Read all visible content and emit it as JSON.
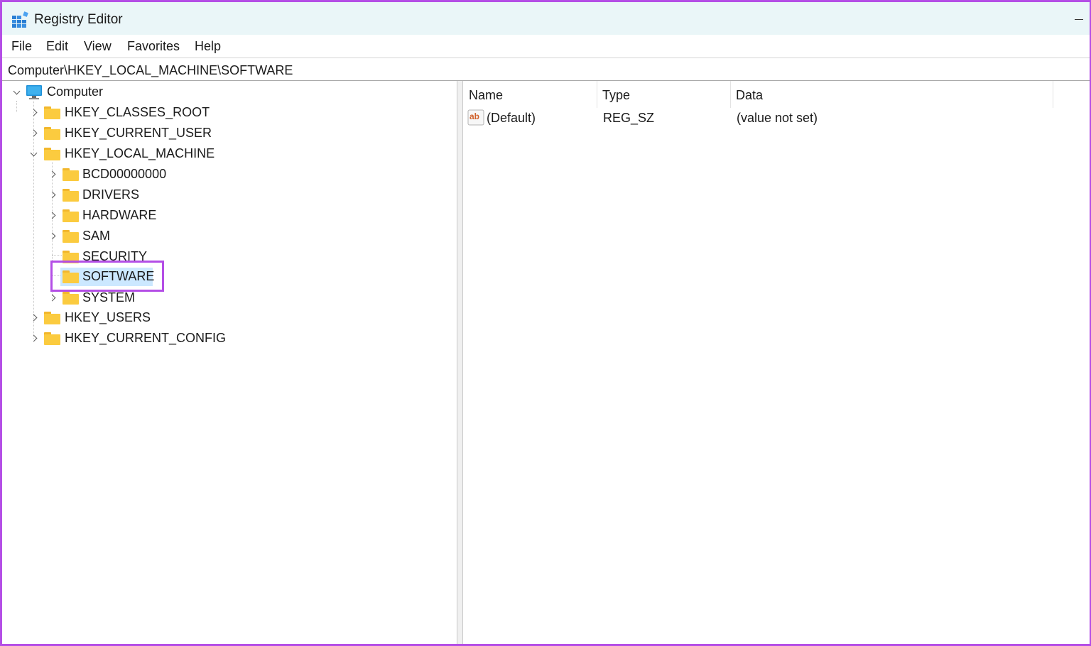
{
  "window": {
    "title": "Registry Editor"
  },
  "menu": {
    "items": [
      "File",
      "Edit",
      "View",
      "Favorites",
      "Help"
    ]
  },
  "address": {
    "path": "Computer\\HKEY_LOCAL_MACHINE\\SOFTWARE"
  },
  "tree": {
    "root": "Computer",
    "hives": {
      "classes_root": "HKEY_CLASSES_ROOT",
      "current_user": "HKEY_CURRENT_USER",
      "local_machine": "HKEY_LOCAL_MACHINE",
      "users": "HKEY_USERS",
      "current_config": "HKEY_CURRENT_CONFIG"
    },
    "local_machine_children": [
      "BCD00000000",
      "DRIVERS",
      "HARDWARE",
      "SAM",
      "SECURITY",
      "SOFTWARE",
      "SYSTEM"
    ],
    "selected": "SOFTWARE"
  },
  "values": {
    "columns": [
      "Name",
      "Type",
      "Data"
    ],
    "rows": [
      {
        "name": "(Default)",
        "type": "REG_SZ",
        "data": "(value not set)",
        "icon": "string-value-icon"
      }
    ]
  },
  "colors": {
    "annotation": "#b44ee6",
    "selection": "#cce8ff",
    "folder": "#fbcb3f",
    "titlebar": "#eaf6f8"
  }
}
